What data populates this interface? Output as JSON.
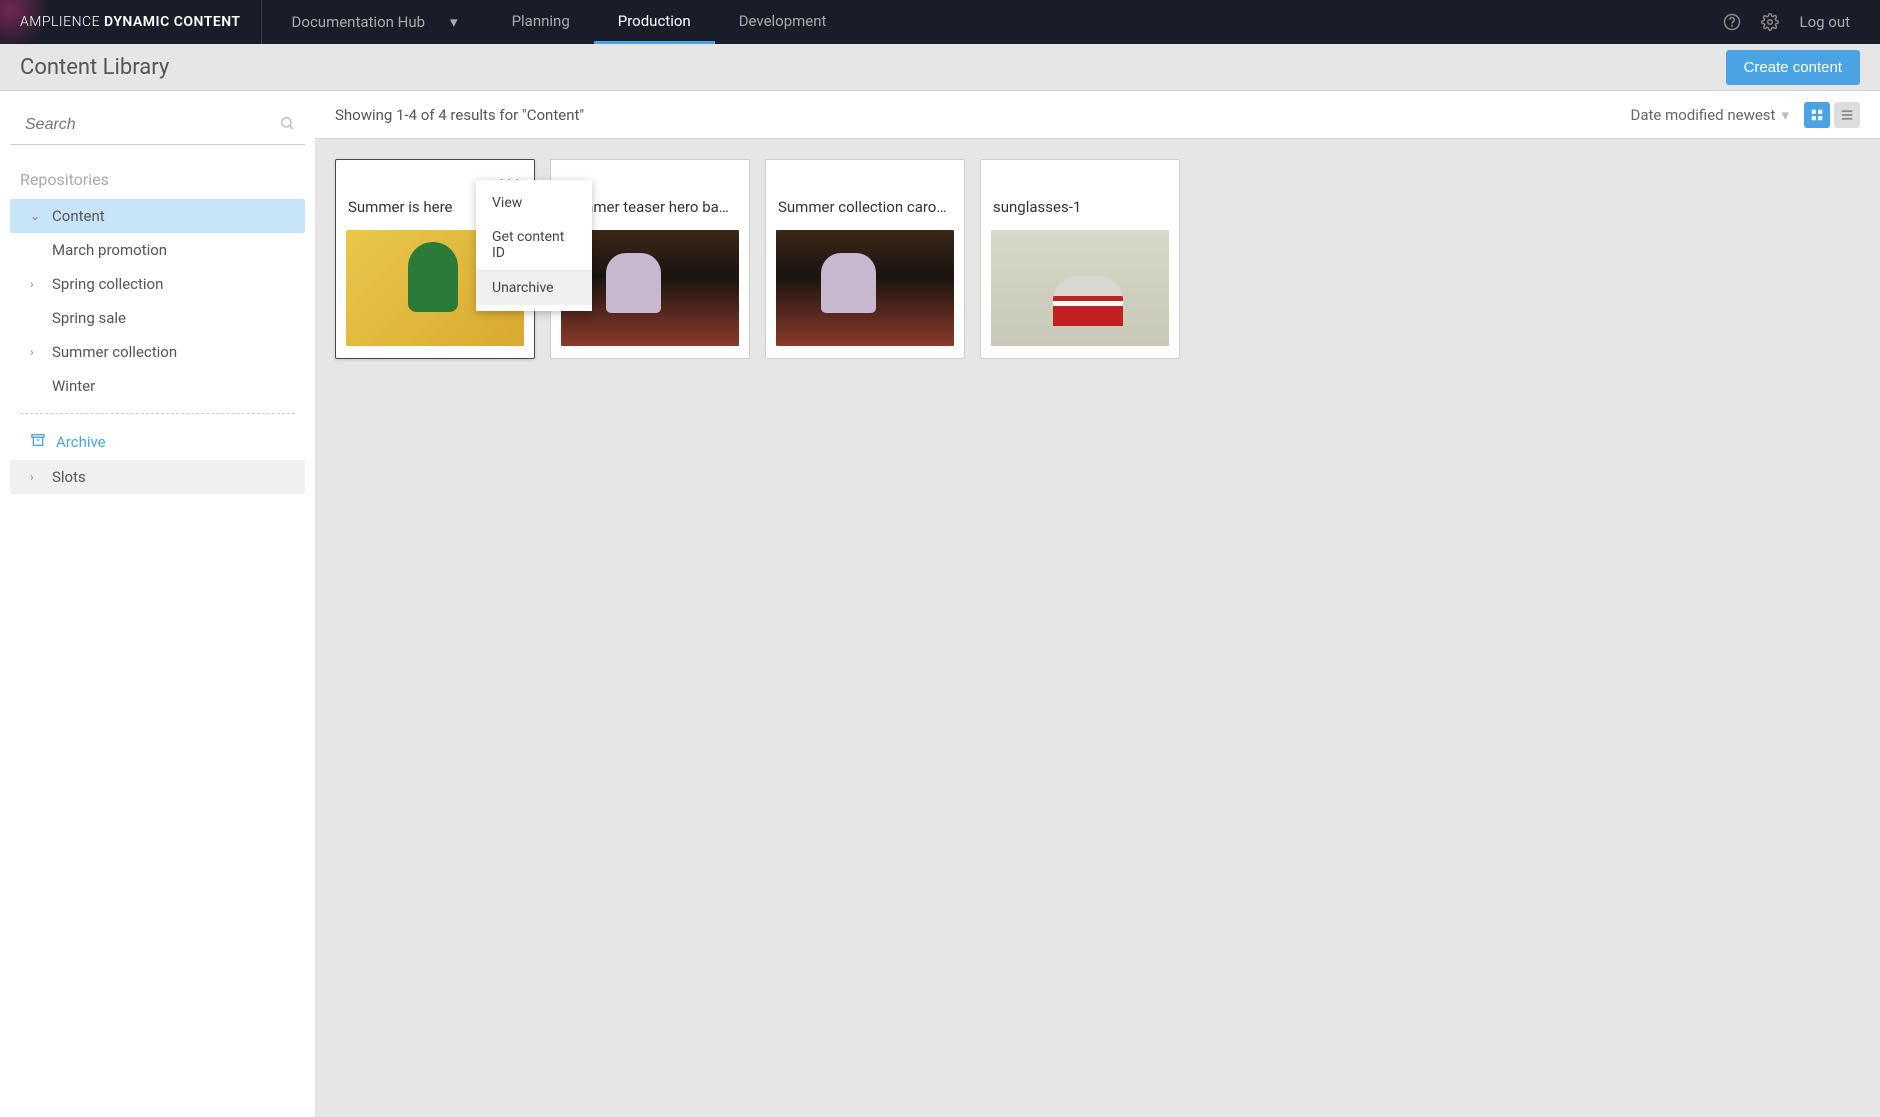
{
  "brand": {
    "light": "AMPLIENCE",
    "bold": "DYNAMIC CONTENT"
  },
  "hub_selector": "Documentation Hub",
  "nav": [
    "Planning",
    "Production",
    "Development"
  ],
  "nav_active_index": 1,
  "logout": "Log out",
  "page_title": "Content Library",
  "create_button": "Create content",
  "search": {
    "placeholder": "Search"
  },
  "sidebar": {
    "repos_label": "Repositories",
    "content_label": "Content",
    "items": [
      {
        "label": "March promotion"
      },
      {
        "label": "Spring collection",
        "expandable": true
      },
      {
        "label": "Spring sale"
      },
      {
        "label": "Summer collection",
        "expandable": true
      },
      {
        "label": "Winter"
      }
    ],
    "archive_label": "Archive",
    "slots_label": "Slots"
  },
  "results_text": "Showing 1-4 of 4 results for \"Content\"",
  "sort_label": "Date modified newest",
  "cards": [
    {
      "title": "Summer is here"
    },
    {
      "title": "Summer teaser hero banner"
    },
    {
      "title": "Summer collection carousel"
    },
    {
      "title": "sunglasses-1"
    }
  ],
  "context_menu": {
    "view": "View",
    "get_id": "Get content ID",
    "unarchive": "Unarchive"
  }
}
